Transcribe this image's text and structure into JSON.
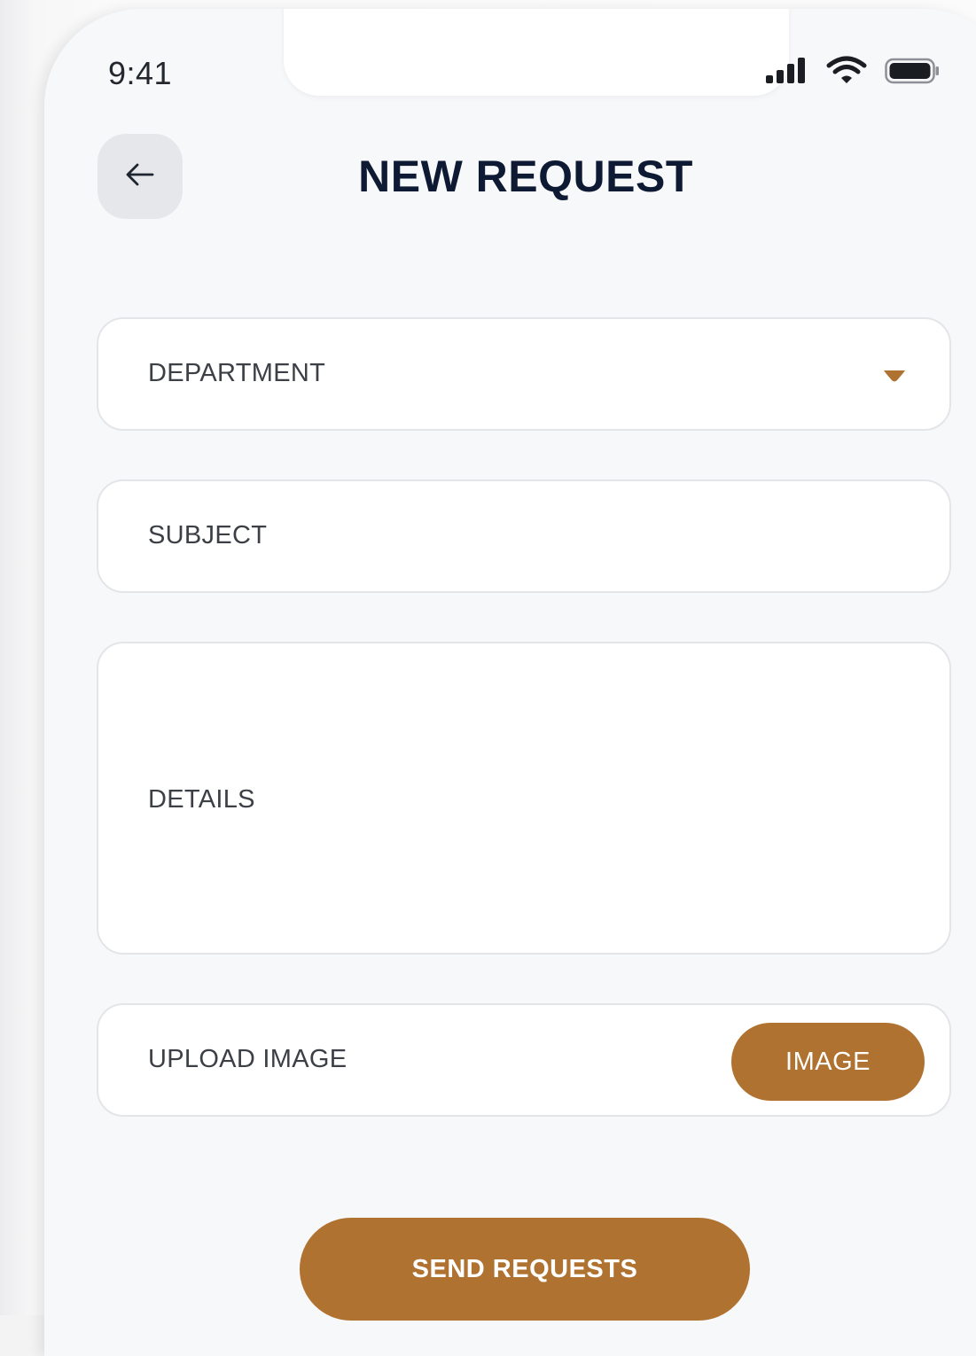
{
  "status_bar": {
    "time": "9:41",
    "icons": [
      "cellular-signal-icon",
      "wifi-icon",
      "battery-icon"
    ]
  },
  "header": {
    "back_icon": "arrow-left-icon",
    "title": "NEW REQUEST"
  },
  "form": {
    "department": {
      "placeholder": "DEPARTMENT",
      "icon": "caret-down-icon"
    },
    "subject": {
      "placeholder": "SUBJECT"
    },
    "details": {
      "placeholder": "DETAILS"
    },
    "upload": {
      "label": "UPLOAD IMAGE",
      "button_label": "IMAGE"
    }
  },
  "actions": {
    "submit_label": "SEND REQUESTS"
  },
  "colors": {
    "accent": "#b07230",
    "title": "#0e1a33",
    "field_border": "#e4e5e8",
    "background": "#f7f8fa"
  }
}
